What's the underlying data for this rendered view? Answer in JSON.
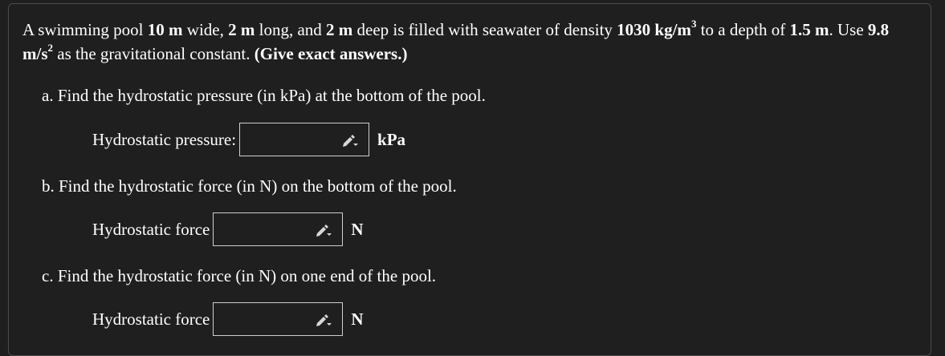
{
  "problem": {
    "part1": "A swimming pool",
    "width": "10 m",
    "part2": "wide,",
    "length": "2 m",
    "part3": "long, and",
    "depth": "2 m",
    "part4": "deep is filled with seawater of density",
    "density": "1030 kg/m",
    "density_exp": "3",
    "part5": "to a depth of",
    "fill_depth": "1.5 m",
    "part6": ". Use",
    "g": "9.8 m/s",
    "g_exp": "2",
    "part7": "as the gravitational constant.",
    "emphasis": "(Give exact answers.)"
  },
  "parts": [
    {
      "question": "a. Find the hydrostatic pressure (in kPa) at the bottom of the pool.",
      "label": "Hydrostatic pressure:",
      "value": "",
      "unit": "kPa"
    },
    {
      "question": "b. Find the hydrostatic force (in N) on the bottom of the pool.",
      "label": "Hydrostatic force",
      "value": "",
      "unit": "N"
    },
    {
      "question": "c. Find the hydrostatic force (in N) on one end of the pool.",
      "label": "Hydrostatic force",
      "value": "",
      "unit": "N"
    }
  ],
  "icons": {
    "edit": "pencil-dropdown-icon"
  }
}
